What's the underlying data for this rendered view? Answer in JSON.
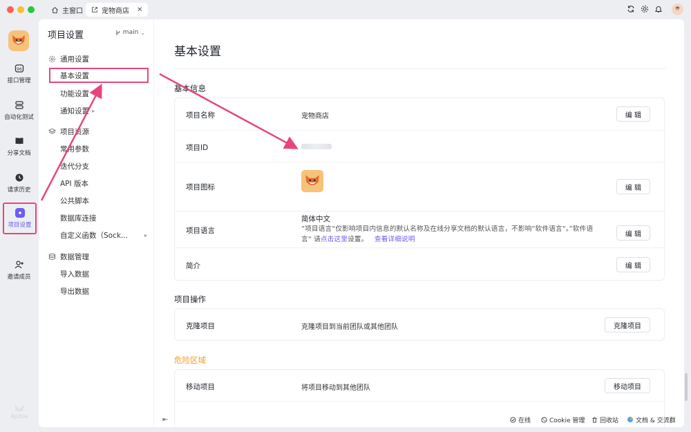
{
  "window": {
    "tabs": [
      {
        "label": "主窗口",
        "icon": "home-icon"
      },
      {
        "label": "宠物商店",
        "icon": "external-link-icon"
      }
    ],
    "traffic_lights": {
      "close": "#ff5f57",
      "min": "#febc2e",
      "max": "#28c840"
    }
  },
  "rail": {
    "items": [
      {
        "label": "接口管理",
        "icon": "api-icon"
      },
      {
        "label": "自动化测试",
        "icon": "database-icon"
      },
      {
        "label": "分享文档",
        "icon": "book-icon"
      },
      {
        "label": "请求历史",
        "icon": "clock-icon"
      },
      {
        "label": "项目设置",
        "icon": "hexagon-icon"
      },
      {
        "label": "邀请成员",
        "icon": "user-plus-icon"
      }
    ],
    "brand": "Apifox"
  },
  "sidebar": {
    "title": "项目设置",
    "branch": "main",
    "groups": [
      {
        "label": "通用设置",
        "icon": "gear-icon",
        "items": [
          "基本设置",
          "功能设置",
          "通知设置"
        ]
      },
      {
        "label": "项目资源",
        "icon": "layers-icon",
        "items": [
          "常用参数",
          "迭代分支",
          "API 版本",
          "公共脚本",
          "数据库连接",
          "自定义函数（Sock..."
        ]
      },
      {
        "label": "数据管理",
        "icon": "database-icon",
        "items": [
          "导入数据",
          "导出数据"
        ]
      }
    ]
  },
  "main": {
    "page_title": "基本设置",
    "basic_info": {
      "title": "基本信息",
      "name_label": "项目名称",
      "name_value": "宠物商店",
      "id_label": "项目ID",
      "icon_label": "项目图标",
      "lang_label": "项目语言",
      "lang_value": "简体中文",
      "lang_desc_1": "”项目语言“仅影响项目内信息的默认名称及在线分享文档的默认语言，不影响”软件语言“。”软件语",
      "lang_desc_2": "言“ 请",
      "lang_link_here": "点击这里",
      "lang_desc_3": "设置。",
      "lang_link_more": "查看详细说明",
      "intro_label": "简介",
      "edit_label": "编 辑"
    },
    "project_ops": {
      "title": "项目操作",
      "clone_label": "克隆项目",
      "clone_desc": "克隆项目到当前团队或其他团队",
      "clone_button": "克隆项目"
    },
    "danger": {
      "title": "危险区域",
      "move_label": "移动项目",
      "move_desc": "将项目移动到其他团队",
      "move_button": "移动项目"
    }
  },
  "footer": {
    "online": "在线",
    "cookie": "Cookie 管理",
    "trash": "回收站",
    "docs": "文档 & 交流群"
  },
  "colors": {
    "accent": "#6f5cf0",
    "highlight": "#e8457a",
    "danger": "#f59a23"
  }
}
